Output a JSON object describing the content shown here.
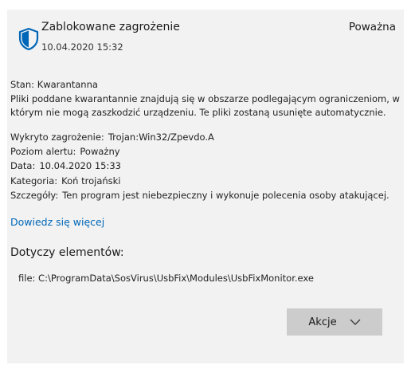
{
  "header": {
    "title": "Zablokowane zagrożenie",
    "date": "10.04.2020 15:32",
    "severity": "Poważna",
    "icon": "shield-icon"
  },
  "status": {
    "label": "Stan:",
    "value": "Kwarantanna",
    "description": "Pliki poddane kwarantannie znajdują się w obszarze podlegającym ograniczeniom, w którym nie mogą zaszkodzić urządzeniu. Te pliki zostaną usunięte automatycznie."
  },
  "details": [
    {
      "label": "Wykryto zagrożenie:",
      "value": "Trojan:Win32/Zpevdo.A"
    },
    {
      "label": "Poziom alertu:",
      "value": "Poważny"
    },
    {
      "label": "Data:",
      "value": "10.04.2020 15:33"
    },
    {
      "label": "Kategoria:",
      "value": "Koń trojański"
    },
    {
      "label": "Szczegóły:",
      "value": "Ten program jest niebezpieczny i wykonuje polecenia osoby atakującej."
    }
  ],
  "learn_more": "Dowiedz się więcej",
  "affected": {
    "heading": "Dotyczy elementów:",
    "items": [
      "file: C:\\ProgramData\\SosVirus\\UsbFix\\Modules\\UsbFixMonitor.exe"
    ]
  },
  "actions": {
    "label": "Akcje",
    "icon": "chevron-down-icon"
  },
  "colors": {
    "panel_bg": "#f2f2f2",
    "link": "#0067b8",
    "shield": "#0067b8",
    "button_bg": "#cccccc"
  }
}
